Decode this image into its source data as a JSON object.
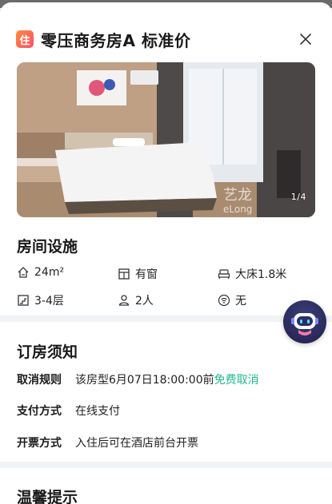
{
  "header": {
    "brand_icon_text": "住",
    "title": "零压商务房A 标准价"
  },
  "photo": {
    "counter": "1/4",
    "watermark": "艺龙 eLong"
  },
  "facilities": {
    "heading": "房间设施",
    "items": [
      {
        "icon": "house-icon",
        "label": "24m²"
      },
      {
        "icon": "window-icon",
        "label": "有窗"
      },
      {
        "icon": "bed-icon",
        "label": "大床1.8米"
      },
      {
        "icon": "floor-icon",
        "label": "3-4层"
      },
      {
        "icon": "person-icon",
        "label": "2人"
      },
      {
        "icon": "wifi-icon",
        "label": "无"
      }
    ]
  },
  "booking": {
    "heading": "订房须知",
    "cancel_label": "取消规则",
    "cancel_value": "该房型6月07日18:00:00前",
    "cancel_free": "免费取消",
    "pay_label": "支付方式",
    "pay_value": "在线支付",
    "invoice_label": "开票方式",
    "invoice_value": "入住后可在酒店前台开票"
  },
  "tips": {
    "heading": "温馨提示"
  },
  "colors": {
    "accent_green": "#22b88e",
    "brand_orange": "#ff6a3d"
  }
}
